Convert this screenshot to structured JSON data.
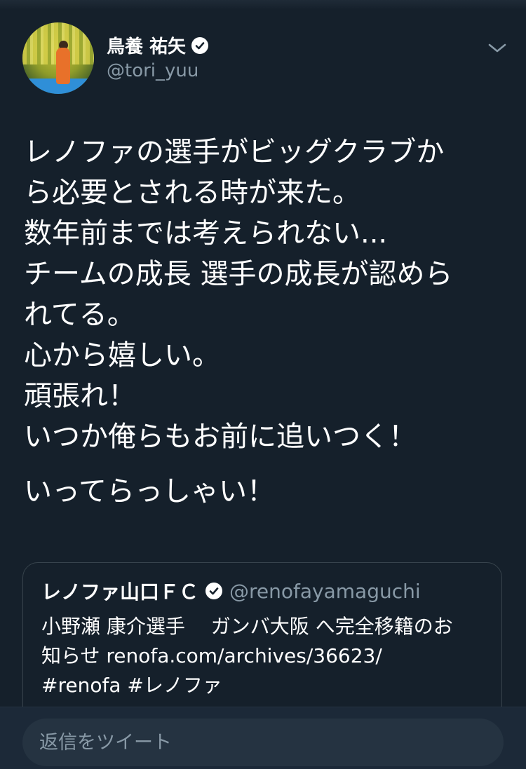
{
  "tweet": {
    "author": {
      "display_name": "鳥養 祐矢",
      "handle": "@tori_yuu",
      "verified": true
    },
    "lines": [
      "レノファの選手がビッグクラブか",
      "ら必要とされる時が来た。",
      "数年前までは考えられない...",
      "チームの成長 選手の成長が認めら",
      "れてる。",
      "心から嬉しい。",
      "頑張れ！",
      "いつか俺らもお前に追いつく！"
    ],
    "closing_line": "いってらっしゃい！"
  },
  "quote": {
    "name": "レノファ山口ＦＣ",
    "handle": "@renofayamaguchi",
    "verified": true,
    "lines": [
      "小野瀬 康介選手　 ガンバ大阪 へ完全移籍のお",
      "知らせ renofa.com/archives/36623/",
      "#renofa #レノファ"
    ]
  },
  "reply": {
    "placeholder": "返信をツイート"
  },
  "icons": {
    "avatar": "profile-photo",
    "verified": "verified-badge-icon",
    "menu": "chevron-down-icon"
  },
  "colors": {
    "background": "#15202b",
    "secondary_text": "#8899a6",
    "border": "#38444d"
  }
}
